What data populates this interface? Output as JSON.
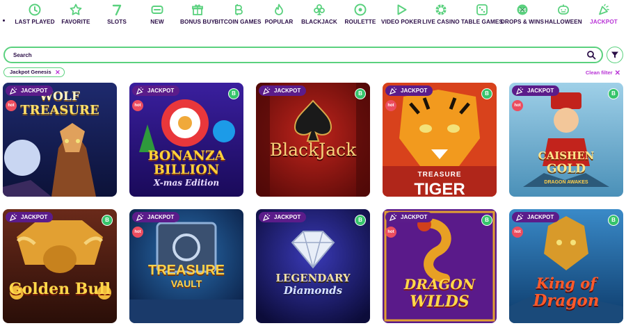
{
  "nav": {
    "items": [
      {
        "label": "LAST PLAYED",
        "icon": "clock-icon",
        "active": false
      },
      {
        "label": "FAVORITE",
        "icon": "star-icon",
        "active": false
      },
      {
        "label": "SLOTS",
        "icon": "seven-icon",
        "active": false
      },
      {
        "label": "NEW",
        "icon": "new-tag-icon",
        "active": false
      },
      {
        "label": "BONUS BUY",
        "icon": "gift-icon",
        "active": false
      },
      {
        "label": "BITCOIN GAMES",
        "icon": "bitcoin-icon",
        "active": false
      },
      {
        "label": "POPULAR",
        "icon": "flame-icon",
        "active": false
      },
      {
        "label": "BLACKJACK",
        "icon": "club-icon",
        "active": false
      },
      {
        "label": "ROULETTE",
        "icon": "roulette-icon",
        "active": false
      },
      {
        "label": "VIDEO POKER",
        "icon": "play-icon",
        "active": false
      },
      {
        "label": "LIVE CASINO",
        "icon": "chip-icon",
        "active": false
      },
      {
        "label": "TABLE GAMES",
        "icon": "dice-icon",
        "active": false
      },
      {
        "label": "DROPS & WINS",
        "icon": "drops-icon",
        "active": false
      },
      {
        "label": "HALLOWEEN",
        "icon": "pumpkin-icon",
        "active": false
      },
      {
        "label": "JACKPOT",
        "icon": "party-icon",
        "active": true
      }
    ]
  },
  "search": {
    "placeholder": "Search"
  },
  "filter": {
    "chip": "Jackpot Genesis",
    "chip_close": "✕",
    "clean_label": "Clean filter",
    "clean_icon": "✕"
  },
  "badges": {
    "jackpot": "JACKPOT",
    "hot": "hot",
    "bitcoin": "B"
  },
  "games": [
    {
      "title_lines": [
        "WOLF",
        "TREASURE"
      ],
      "hot": true,
      "bitcoin": false
    },
    {
      "title_lines": [
        "BONANZA",
        "BILLION",
        "X-mas Edition"
      ],
      "hot": true,
      "bitcoin": true
    },
    {
      "title_lines": [
        "BlackJack"
      ],
      "hot": false,
      "bitcoin": true
    },
    {
      "title_lines": [
        "TREASURE",
        "TIGER"
      ],
      "hot": true,
      "bitcoin": true
    },
    {
      "title_lines": [
        "CAISHEN",
        "GOLD",
        "DRAGON AWAKES"
      ],
      "hot": true,
      "bitcoin": true
    },
    {
      "title_lines": [
        "Golden Bull"
      ],
      "hot": false,
      "bitcoin": true
    },
    {
      "title_lines": [
        "TREASURE",
        "VAULT"
      ],
      "hot": true,
      "bitcoin": false
    },
    {
      "title_lines": [
        "LEGENDARY",
        "Diamonds"
      ],
      "hot": false,
      "bitcoin": true
    },
    {
      "title_lines": [
        "DRAGON",
        "WILDS"
      ],
      "hot": true,
      "bitcoin": true
    },
    {
      "title_lines": [
        "King of",
        "Dragon"
      ],
      "hot": true,
      "bitcoin": true
    }
  ],
  "colors": {
    "accent": "#b833d6",
    "green": "#5ad17e",
    "jackpot_badge": "#5b1c8a",
    "hot_badge": "#ec4d5f",
    "bitcoin_badge": "#36c46b",
    "text": "#2b0e47"
  }
}
